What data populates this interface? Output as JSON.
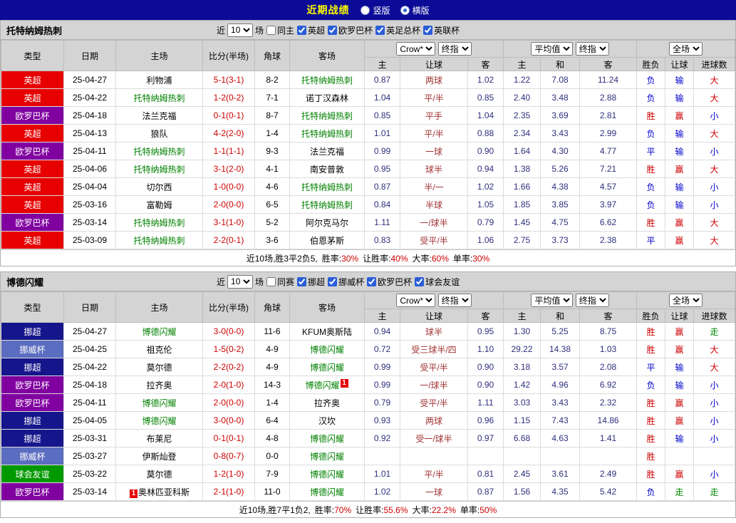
{
  "topbar": {
    "title": "近期战绩",
    "radios": [
      {
        "label": "竖版",
        "checked": false
      },
      {
        "label": "横版",
        "checked": true
      }
    ]
  },
  "colors": {
    "topbar_bg": "#0b0b97",
    "header_bg": "#d4d4d4",
    "score": "#cc0000",
    "focus_team": "#008000",
    "odds": "#2f2f7d",
    "handicap": "#a03333",
    "red": "#cc0000",
    "blue": "#0000cc",
    "green": "#008800",
    "badge": "#e60000"
  },
  "league_colors": {
    "英超": "#e60000",
    "欧罗巴杯": "#8000a0",
    "挪超": "#16168c",
    "挪威杯": "#5b6dc0",
    "球会友谊": "#009900"
  },
  "result_colors": {
    "胜": "#cc0000",
    "赢": "#cc0000",
    "大": "#cc0000",
    "平": "#0000cc",
    "负": "#0000cc",
    "输": "#0000cc",
    "小": "#0000cc",
    "走": "#008800"
  },
  "headers": {
    "type": "类型",
    "date": "日期",
    "home": "主场",
    "score": "比分(半场)",
    "corner": "角球",
    "away": "客场",
    "odds1_select1": "Crow*",
    "odds1_select2": "终指",
    "odds1_cols": [
      "主",
      "让球",
      "客"
    ],
    "odds2_select1": "平均值",
    "odds2_select2": "终指",
    "odds2_cols": [
      "主",
      "和",
      "客"
    ],
    "result_select": "全场",
    "result_cols": [
      "胜负",
      "让球",
      "进球数"
    ]
  },
  "tables": [
    {
      "team": "托特纳姆热刺",
      "filter": {
        "near_label": "近",
        "count": "10",
        "unit_label": "场",
        "same_label": "同主",
        "same_checked": false,
        "leagues": [
          "英超",
          "欧罗巴杯",
          "英足总杯",
          "英联杯"
        ],
        "leagues_checked": true
      },
      "rows": [
        {
          "league": "英超",
          "date": "25-04-27",
          "home": "利物浦",
          "home_focus": false,
          "score": "5-1(3-1)",
          "corner": "8-2",
          "away": "托特纳姆热刺",
          "away_focus": true,
          "o1": "0.87",
          "hcp": "两球",
          "o2": "1.02",
          "a1": "1.22",
          "a2": "7.08",
          "a3": "11.24",
          "r1": "负",
          "r2": "输",
          "r3": "大"
        },
        {
          "league": "英超",
          "date": "25-04-22",
          "home": "托特纳姆热刺",
          "home_focus": true,
          "score": "1-2(0-2)",
          "corner": "7-1",
          "away": "诺丁汉森林",
          "away_focus": false,
          "o1": "1.04",
          "hcp": "平/半",
          "o2": "0.85",
          "a1": "2.40",
          "a2": "3.48",
          "a3": "2.88",
          "r1": "负",
          "r2": "输",
          "r3": "大"
        },
        {
          "league": "欧罗巴杯",
          "date": "25-04-18",
          "home": "法兰克福",
          "home_focus": false,
          "score": "0-1(0-1)",
          "corner": "8-7",
          "away": "托特纳姆热刺",
          "away_focus": true,
          "o1": "0.85",
          "hcp": "平手",
          "o2": "1.04",
          "a1": "2.35",
          "a2": "3.69",
          "a3": "2.81",
          "r1": "胜",
          "r2": "赢",
          "r3": "小"
        },
        {
          "league": "英超",
          "date": "25-04-13",
          "home": "狼队",
          "home_focus": false,
          "score": "4-2(2-0)",
          "corner": "1-4",
          "away": "托特纳姆热刺",
          "away_focus": true,
          "o1": "1.01",
          "hcp": "平/半",
          "o2": "0.88",
          "a1": "2.34",
          "a2": "3.43",
          "a3": "2.99",
          "r1": "负",
          "r2": "输",
          "r3": "大"
        },
        {
          "league": "欧罗巴杯",
          "date": "25-04-11",
          "home": "托特纳姆热刺",
          "home_focus": true,
          "score": "1-1(1-1)",
          "corner": "9-3",
          "away": "法兰克福",
          "away_focus": false,
          "o1": "0.99",
          "hcp": "一球",
          "o2": "0.90",
          "a1": "1.64",
          "a2": "4.30",
          "a3": "4.77",
          "r1": "平",
          "r2": "输",
          "r3": "小"
        },
        {
          "league": "英超",
          "date": "25-04-06",
          "home": "托特纳姆热刺",
          "home_focus": true,
          "score": "3-1(2-0)",
          "corner": "4-1",
          "away": "南安普敦",
          "away_focus": false,
          "o1": "0.95",
          "hcp": "球半",
          "o2": "0.94",
          "a1": "1.38",
          "a2": "5.26",
          "a3": "7.21",
          "r1": "胜",
          "r2": "赢",
          "r3": "大"
        },
        {
          "league": "英超",
          "date": "25-04-04",
          "home": "切尔西",
          "home_focus": false,
          "score": "1-0(0-0)",
          "corner": "4-6",
          "away": "托特纳姆热刺",
          "away_focus": true,
          "o1": "0.87",
          "hcp": "半/一",
          "o2": "1.02",
          "a1": "1.66",
          "a2": "4.38",
          "a3": "4.57",
          "r1": "负",
          "r2": "输",
          "r3": "小"
        },
        {
          "league": "英超",
          "date": "25-03-16",
          "home": "富勒姆",
          "home_focus": false,
          "score": "2-0(0-0)",
          "corner": "6-5",
          "away": "托特纳姆热刺",
          "away_focus": true,
          "o1": "0.84",
          "hcp": "半球",
          "o2": "1.05",
          "a1": "1.85",
          "a2": "3.85",
          "a3": "3.97",
          "r1": "负",
          "r2": "输",
          "r3": "小"
        },
        {
          "league": "欧罗巴杯",
          "date": "25-03-14",
          "home": "托特纳姆热刺",
          "home_focus": true,
          "score": "3-1(1-0)",
          "corner": "5-2",
          "away": "阿尔克马尔",
          "away_focus": false,
          "o1": "1.11",
          "hcp": "一/球半",
          "o2": "0.79",
          "a1": "1.45",
          "a2": "4.75",
          "a3": "6.62",
          "r1": "胜",
          "r2": "赢",
          "r3": "大"
        },
        {
          "league": "英超",
          "date": "25-03-09",
          "home": "托特纳姆热刺",
          "home_focus": true,
          "score": "2-2(0-1)",
          "corner": "3-6",
          "away": "伯恩茅斯",
          "away_focus": false,
          "o1": "0.83",
          "hcp": "受平/半",
          "o2": "1.06",
          "a1": "2.75",
          "a2": "3.73",
          "a3": "2.38",
          "r1": "平",
          "r2": "赢",
          "r3": "大"
        }
      ],
      "summary": {
        "prefix": "近10场,胜3平2负5, ",
        "stats": [
          {
            "label": "胜率:",
            "value": "30%"
          },
          {
            "label": "让胜率:",
            "value": "40%"
          },
          {
            "label": "大率:",
            "value": "60%"
          },
          {
            "label": "单率:",
            "value": "30%"
          }
        ]
      }
    },
    {
      "team": "博德闪耀",
      "filter": {
        "near_label": "近",
        "count": "10",
        "unit_label": "场",
        "same_label": "同赛",
        "same_checked": false,
        "leagues": [
          "挪超",
          "挪威杯",
          "欧罗巴杯",
          "球会友谊"
        ],
        "leagues_checked": true
      },
      "rows": [
        {
          "league": "挪超",
          "date": "25-04-27",
          "home": "博德闪耀",
          "home_focus": true,
          "score": "3-0(0-0)",
          "corner": "11-6",
          "away": "KFUM奥斯陆",
          "away_focus": false,
          "o1": "0.94",
          "hcp": "球半",
          "o2": "0.95",
          "a1": "1.30",
          "a2": "5.25",
          "a3": "8.75",
          "r1": "胜",
          "r2": "赢",
          "r3": "走"
        },
        {
          "league": "挪威杯",
          "date": "25-04-25",
          "home": "祖克伦",
          "home_focus": false,
          "score": "1-5(0-2)",
          "corner": "4-9",
          "away": "博德闪耀",
          "away_focus": true,
          "o1": "0.72",
          "hcp": "受三球半/四",
          "o2": "1.10",
          "a1": "29.22",
          "a2": "14.38",
          "a3": "1.03",
          "r1": "胜",
          "r2": "赢",
          "r3": "大"
        },
        {
          "league": "挪超",
          "date": "25-04-22",
          "home": "莫尔德",
          "home_focus": false,
          "score": "2-2(0-2)",
          "corner": "4-9",
          "away": "博德闪耀",
          "away_focus": true,
          "o1": "0.99",
          "hcp": "受平/半",
          "o2": "0.90",
          "a1": "3.18",
          "a2": "3.57",
          "a3": "2.08",
          "r1": "平",
          "r2": "输",
          "r3": "大"
        },
        {
          "league": "欧罗巴杯",
          "date": "25-04-18",
          "home": "拉齐奥",
          "home_focus": false,
          "score": "2-0(1-0)",
          "corner": "14-3",
          "away": "博德闪耀",
          "away_focus": true,
          "away_badge": "1",
          "o1": "0.99",
          "hcp": "一/球半",
          "o2": "0.90",
          "a1": "1.42",
          "a2": "4.96",
          "a3": "6.92",
          "r1": "负",
          "r2": "输",
          "r3": "小"
        },
        {
          "league": "欧罗巴杯",
          "date": "25-04-11",
          "home": "博德闪耀",
          "home_focus": true,
          "score": "2-0(0-0)",
          "corner": "1-4",
          "away": "拉齐奥",
          "away_focus": false,
          "o1": "0.79",
          "hcp": "受平/半",
          "o2": "1.11",
          "a1": "3.03",
          "a2": "3.43",
          "a3": "2.32",
          "r1": "胜",
          "r2": "赢",
          "r3": "小"
        },
        {
          "league": "挪超",
          "date": "25-04-05",
          "home": "博德闪耀",
          "home_focus": true,
          "score": "3-0(0-0)",
          "corner": "6-4",
          "away": "汉坎",
          "away_focus": false,
          "o1": "0.93",
          "hcp": "两球",
          "o2": "0.96",
          "a1": "1.15",
          "a2": "7.43",
          "a3": "14.86",
          "r1": "胜",
          "r2": "赢",
          "r3": "小"
        },
        {
          "league": "挪超",
          "date": "25-03-31",
          "home": "布莱尼",
          "home_focus": false,
          "score": "0-1(0-1)",
          "corner": "4-8",
          "away": "博德闪耀",
          "away_focus": true,
          "o1": "0.92",
          "hcp": "受一/球半",
          "o2": "0.97",
          "a1": "6.68",
          "a2": "4.63",
          "a3": "1.41",
          "r1": "胜",
          "r2": "输",
          "r3": "小"
        },
        {
          "league": "挪威杯",
          "date": "25-03-27",
          "home": "伊斯灿登",
          "home_focus": false,
          "score": "0-8(0-7)",
          "corner": "0-0",
          "away": "博德闪耀",
          "away_focus": true,
          "o1": "",
          "hcp": "",
          "o2": "",
          "a1": "",
          "a2": "",
          "a3": "",
          "r1": "胜",
          "r2": "",
          "r3": ""
        },
        {
          "league": "球会友谊",
          "date": "25-03-22",
          "home": "莫尔德",
          "home_focus": false,
          "score": "1-2(1-0)",
          "corner": "7-9",
          "away": "博德闪耀",
          "away_focus": true,
          "o1": "1.01",
          "hcp": "平/半",
          "o2": "0.81",
          "a1": "2.45",
          "a2": "3.61",
          "a3": "2.49",
          "r1": "胜",
          "r2": "赢",
          "r3": "小"
        },
        {
          "league": "欧罗巴杯",
          "date": "25-03-14",
          "home": "奥林匹亚科斯",
          "home_focus": false,
          "home_badge": "1",
          "score": "2-1(1-0)",
          "corner": "11-0",
          "away": "博德闪耀",
          "away_focus": true,
          "o1": "1.02",
          "hcp": "一球",
          "o2": "0.87",
          "a1": "1.56",
          "a2": "4.35",
          "a3": "5.42",
          "r1": "负",
          "r2": "走",
          "r3": "走"
        }
      ],
      "summary": {
        "prefix": "近10场,胜7平1负2, ",
        "stats": [
          {
            "label": "胜率:",
            "value": "70%"
          },
          {
            "label": "让胜率:",
            "value": "55.6%"
          },
          {
            "label": "大率:",
            "value": "22.2%"
          },
          {
            "label": "单率:",
            "value": "50%"
          }
        ]
      }
    }
  ]
}
